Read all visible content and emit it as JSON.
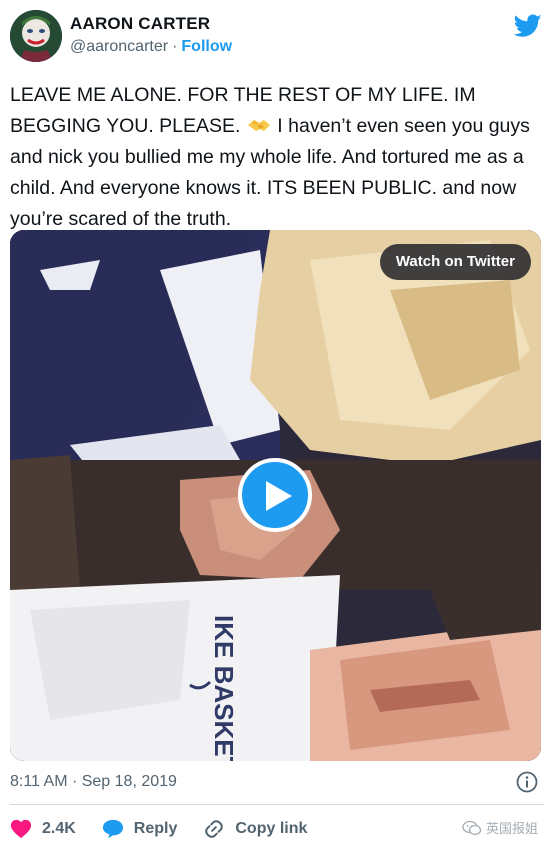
{
  "author": {
    "display_name": "AARON CARTER",
    "handle": "@aaroncarter",
    "separator": "·",
    "follow_label": "Follow"
  },
  "tweet": {
    "text_part1": "LEAVE ME ALONE. FOR THE REST OF MY LIFE. IM BEGGING YOU. PLEASE. ",
    "emoji": "handshake-emoji",
    "text_part2": " I haven’t even seen you guys and nick you bullied me my whole life. And tortured me as a child. And everyone knows it. ITS BEEN PUBLIC. and now you’re scared of the truth.",
    "timestamp": "8:11 AM · Sep 18, 2019"
  },
  "media": {
    "watch_label": "Watch on Twitter",
    "shirt_text": "IKE BASKETB"
  },
  "actions": {
    "likes": "2.4K",
    "reply_label": "Reply",
    "copy_link_label": "Copy link"
  },
  "watermark": {
    "text": "英国报姐"
  },
  "colors": {
    "accent": "#1d9bf0",
    "like": "#f91880",
    "secondary_text": "#536471"
  },
  "icons": [
    "twitter-logo-icon",
    "play-icon",
    "info-icon",
    "heart-icon",
    "reply-icon",
    "link-icon",
    "wechat-icon"
  ]
}
